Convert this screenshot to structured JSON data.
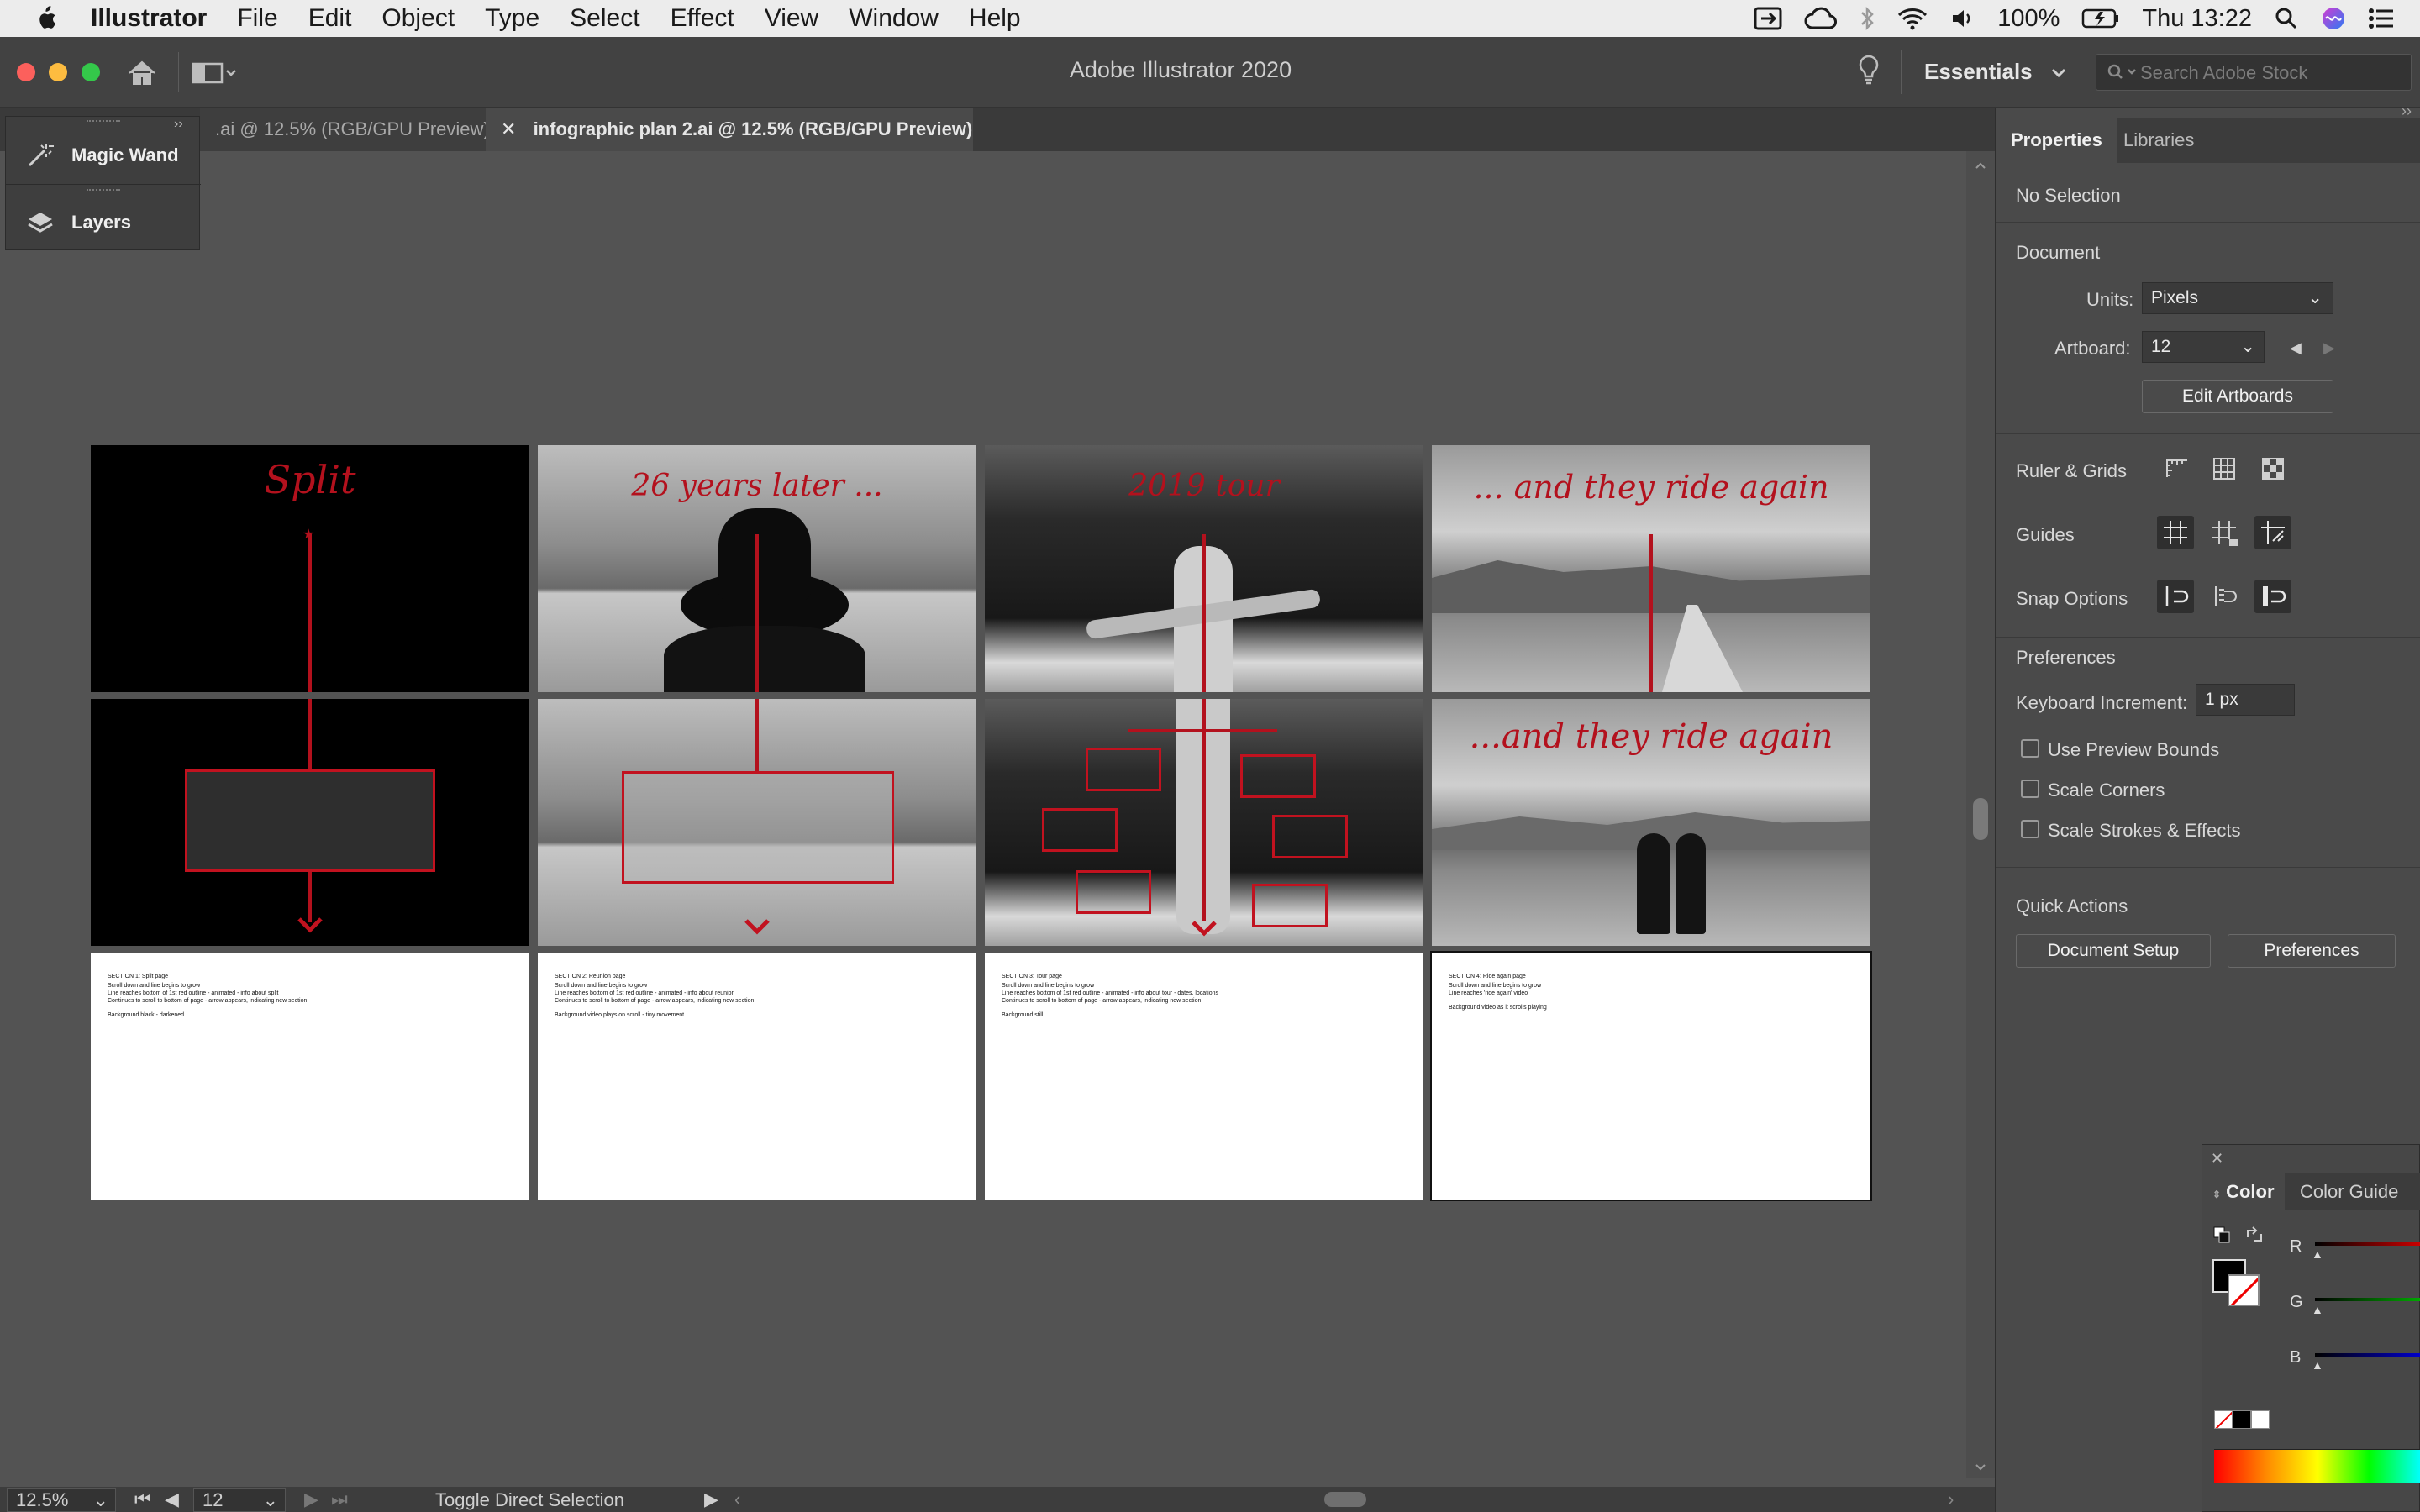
{
  "menubar": {
    "app_name": "Illustrator",
    "items": [
      "File",
      "Edit",
      "Object",
      "Type",
      "Select",
      "Effect",
      "View",
      "Window",
      "Help"
    ],
    "battery": "100%",
    "clock": "Thu 13:22"
  },
  "appbar": {
    "title": "Adobe Illustrator 2020",
    "workspace": "Essentials",
    "search_placeholder": "Search Adobe Stock"
  },
  "tabs": [
    {
      "label": ".ai @ 12.5% (RGB/GPU Preview)"
    },
    {
      "label": "infographic plan 2.ai @ 12.5% (RGB/GPU Preview)"
    }
  ],
  "tool_panel": {
    "items": [
      {
        "label": "Magic Wand",
        "icon": "magic-wand-icon"
      },
      {
        "label": "Layers",
        "icon": "layers-icon"
      }
    ]
  },
  "artboards": {
    "row1": [
      {
        "title": "Split"
      },
      {
        "title": "26 years later ..."
      },
      {
        "title": "2019 tour"
      },
      {
        "title": "... and they ride again"
      }
    ],
    "row2_title": "...and they ride again",
    "notes": [
      {
        "heading": "SECTION 1: Split page",
        "lines": [
          "Scroll down and line begins to grow",
          "Line reaches bottom of 1st red outline - animated - info about split",
          "Continues to scroll to bottom of page - arrow appears, indicating new section",
          "Background black - darkened"
        ]
      },
      {
        "heading": "SECTION 2: Reunion page",
        "lines": [
          "Scroll down and line begins to grow",
          "Line reaches bottom of 1st red outline - animated - info about reunion",
          "Continues to scroll to bottom of page - arrow appears, indicating new section",
          "Background video plays on scroll - tiny movement"
        ]
      },
      {
        "heading": "SECTION 3: Tour page",
        "lines": [
          "Scroll down and line begins to grow",
          "Line reaches bottom of 1st red outline - animated - info about tour - dates, locations",
          "Continues to scroll to bottom of page - arrow appears, indicating new section",
          "Background still"
        ]
      },
      {
        "heading": "SECTION 4: Ride again page",
        "lines": [
          "Scroll down and line begins to grow",
          "Line reaches 'ride again' video",
          "Background video as it scrolls playing"
        ]
      }
    ]
  },
  "properties": {
    "tabs": [
      "Properties",
      "Libraries"
    ],
    "selection": "No Selection",
    "document_heading": "Document",
    "units_label": "Units:",
    "units_value": "Pixels",
    "artboard_label": "Artboard:",
    "artboard_value": "12",
    "edit_artboards": "Edit Artboards",
    "ruler_grids": "Ruler & Grids",
    "guides": "Guides",
    "snap_options": "Snap Options",
    "preferences_heading": "Preferences",
    "keyboard_increment_label": "Keyboard Increment:",
    "keyboard_increment_value": "1 px",
    "checkboxes": [
      "Use Preview Bounds",
      "Scale Corners",
      "Scale Strokes & Effects"
    ],
    "quick_actions": "Quick Actions",
    "document_setup": "Document Setup",
    "preferences_button": "Preferences"
  },
  "color_panel": {
    "tabs": [
      "Color",
      "Color Guide"
    ],
    "channels": [
      "R",
      "G",
      "B"
    ]
  },
  "status": {
    "zoom": "12.5%",
    "artboard": "12",
    "tool": "Toggle Direct Selection"
  },
  "colors": {
    "accent_red": "#b3111d",
    "panel_bg": "#4a4a4a",
    "canvas_bg": "#535353"
  }
}
